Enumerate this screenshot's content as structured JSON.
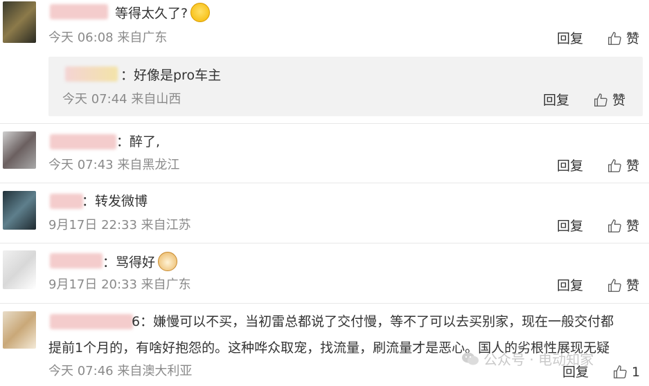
{
  "comments": [
    {
      "text": "等得太久了?",
      "meta": "今天 06:08 来自广东",
      "reply": "回复",
      "like": "赞"
    },
    {
      "text": "：好像是pro车主",
      "meta": "今天 07:44 来自山西",
      "reply": "回复",
      "like": "赞"
    },
    {
      "text": "：醉了,",
      "meta": "今天 07:43 来自黑龙江",
      "reply": "回复",
      "like": "赞"
    },
    {
      "text": "：转发微博",
      "meta": "9月17日 22:33 来自江苏",
      "reply": "回复",
      "like": "赞"
    },
    {
      "text": "：骂得好",
      "meta": "9月17日 20:33 来自广东",
      "reply": "回复",
      "like": "赞"
    },
    {
      "text_line1": "6：嫌慢可以不买，当初雷总都说了交付慢，等不了可以去买别家，现在一般交付都",
      "text_line2": "提前1个月的，有啥好抱怨的。这种哗众取宠，找流量，刷流量才是恶心。国人的劣根性展现无疑",
      "meta": "今天 07:46 来自澳大利亚",
      "reply": "回复",
      "like_count": "1"
    }
  ],
  "watermark": "公众号 · 电动知家",
  "icons": {
    "like": "thumbs-up-icon",
    "emoji_laugh": "laugh-cry-emoji",
    "emoji_doge": "doge-emoji",
    "wechat": "wechat-icon"
  }
}
